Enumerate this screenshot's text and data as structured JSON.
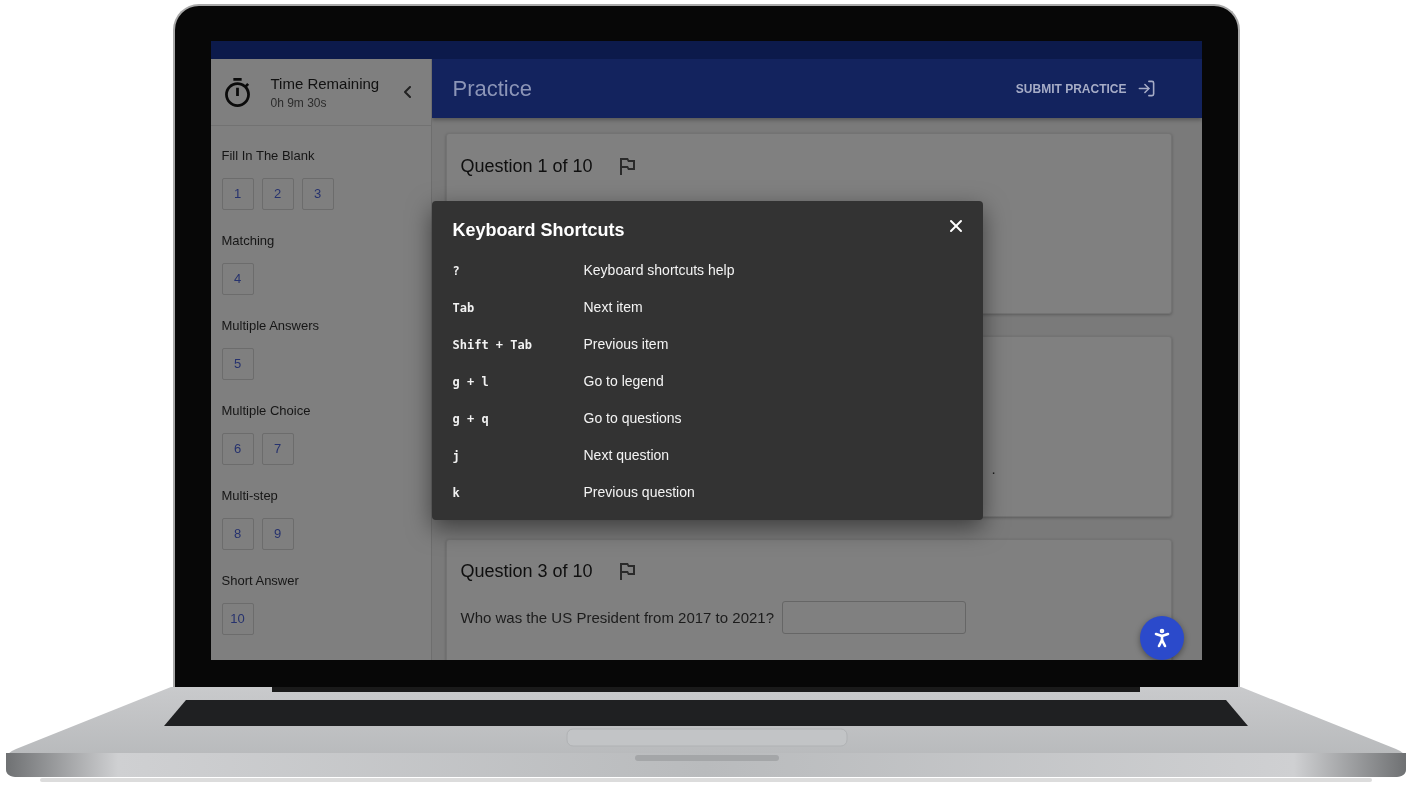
{
  "timer": {
    "label": "Time Remaining",
    "value": "0h 9m 30s"
  },
  "legend": [
    {
      "title": "Fill In The Blank",
      "questions": [
        {
          "number": "1"
        },
        {
          "number": "2"
        },
        {
          "number": "3"
        }
      ]
    },
    {
      "title": "Matching",
      "questions": [
        {
          "number": "4"
        }
      ]
    },
    {
      "title": "Multiple Answers",
      "questions": [
        {
          "number": "5"
        }
      ]
    },
    {
      "title": "Multiple Choice",
      "questions": [
        {
          "number": "6"
        },
        {
          "number": "7"
        }
      ]
    },
    {
      "title": "Multi-step",
      "questions": [
        {
          "number": "8"
        },
        {
          "number": "9"
        }
      ]
    },
    {
      "title": "Short Answer",
      "questions": [
        {
          "number": "10"
        }
      ]
    }
  ],
  "header": {
    "title": "Practice",
    "submit_button": "SUBMIT PRACTICE"
  },
  "questions": [
    {
      "kind": "heading",
      "title": "Question 1 of 10"
    },
    {
      "kind": "tail",
      "tail_text": "."
    },
    {
      "kind": "fill",
      "title": "Question 3 of 10",
      "prompt": "Who was the US President from 2017 to 2021?"
    }
  ],
  "shortcuts_dialog": {
    "title": "Keyboard Shortcuts",
    "shortcuts": [
      {
        "keys": "?",
        "action": "Keyboard shortcuts help"
      },
      {
        "keys": "Tab",
        "action": "Next item"
      },
      {
        "keys": "Shift + Tab",
        "action": "Previous item"
      },
      {
        "keys": "g + l",
        "action": "Go to legend"
      },
      {
        "keys": "g + q",
        "action": "Go to questions"
      },
      {
        "keys": "j",
        "action": "Next question"
      },
      {
        "keys": "k",
        "action": "Previous question"
      }
    ]
  }
}
